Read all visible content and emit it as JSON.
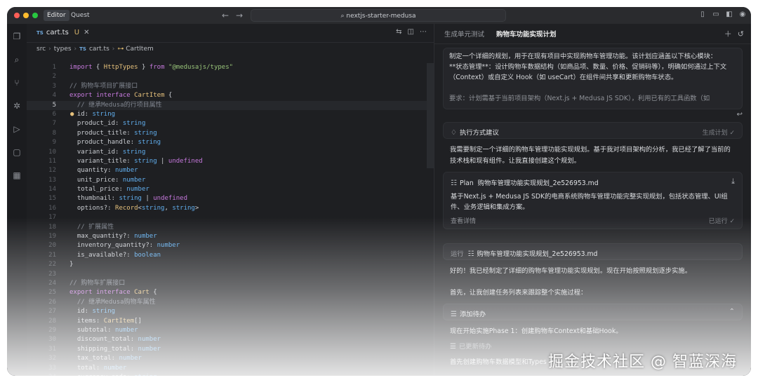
{
  "titlebar": {
    "tabs": [
      "Editor",
      "Quest"
    ],
    "search": "nextjs-starter-medusa"
  },
  "editor": {
    "file_tab": {
      "badge": "TS",
      "name": "cart.ts",
      "status": "U"
    },
    "breadcrumb": [
      "src",
      "types",
      "cart.ts",
      "CartItem"
    ],
    "lines": [
      "import { HttpTypes } from \"@medusajs/types\"",
      "",
      "// 购物车项目扩展接口",
      "export interface CartItem {",
      "  // 继承Medusa的行项目属性",
      "  id: string",
      "  product_id: string",
      "  product_title: string",
      "  product_handle: string",
      "  variant_id: string",
      "  variant_title: string | undefined",
      "  quantity: number",
      "  unit_price: number",
      "  total_price: number",
      "  thumbnail: string | undefined",
      "  options?: Record<string, string>",
      "",
      "  // 扩展属性",
      "  max_quantity?: number",
      "  inventory_quantity?: number",
      "  is_available?: boolean",
      "}",
      "",
      "// 购物车扩展接口",
      "export interface Cart {",
      "  // 继承Medusa购物车属性",
      "  id: string",
      "  items: CartItem[]",
      "  subtotal: number",
      "  discount_total: number",
      "  shipping_total: number",
      "  tax_total: number",
      "  total: number",
      "  currency_code: string"
    ]
  },
  "chat": {
    "tabs": [
      "生成单元测试",
      "购物车功能实现计划"
    ],
    "prompt": [
      "制定一个详细的规划，用于在现有项目中实现购物车管理功能。该计划应涵盖以下核心模块：",
      "**状态管理**：设计购物车数据结构（如商品项、数量、价格、促销码等），明确如何通过上下文（Context）或自定义 Hook（如 useCart）在组件间共享和更新购物车状态。",
      "",
      "要求：计划需基于当前项目架构（Next.js + Medusa JS SDK），利用已有的工具函数（如"
    ],
    "suggestion": {
      "title": "执行方式建议",
      "right": "生成计划"
    },
    "reply1": [
      "我需要制定一个详细的购物车管理功能实现规划。基于我对项目架构的分析，我已经了解了当前的",
      "技术栈和现有组件。让我直接创建这个规划。"
    ],
    "plan_card": {
      "label": "Plan",
      "file": "购物车管理功能实现规划_2e526953.md",
      "desc": [
        "基于Next.js + Medusa JS SDK的电商系统购物车管理功能完整实现规划，包括状态管理、UI组",
        "件、业务逻辑和集成方案。"
      ],
      "details": "查看详情",
      "status": "已运行"
    },
    "run_card": {
      "label": "运行",
      "file": "购物车管理功能实现规划_2e526953.md"
    },
    "reply2": "好的！我已经制定了详细的购物车管理功能实现规划。现在开始按照规划逐步实施。",
    "reply3": "首先，让我创建任务列表来跟踪整个实施过程：",
    "todo_card": {
      "label": "添加待办"
    },
    "reply4": "现在开始实施Phase 1：创建购物车Context和基础Hook。",
    "updated": "已更新待办",
    "reply5": "首先创建购物车数据模型和Types"
  },
  "watermark": "掘金技术社区 @ 智蓝深海"
}
